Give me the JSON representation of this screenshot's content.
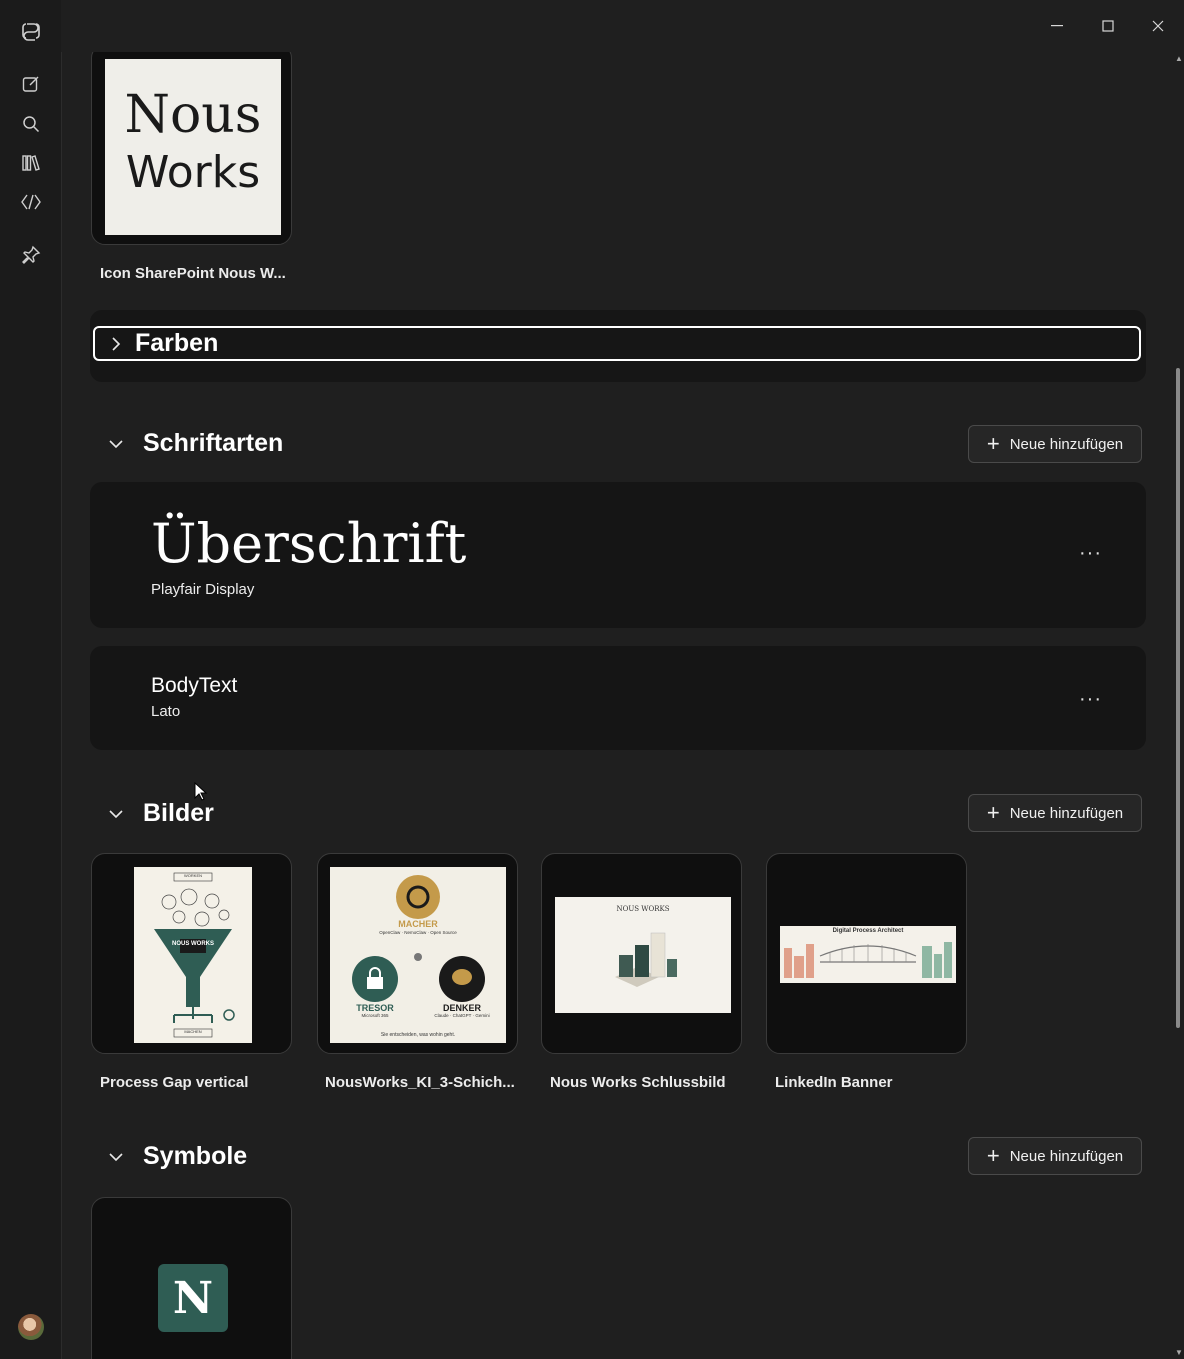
{
  "window": {
    "minimize_glyph": "—",
    "maximize_glyph": "☐",
    "close_glyph": "✕"
  },
  "sidebar": {
    "icons": [
      "copilot-logo-icon",
      "new-chat-icon",
      "search-icon",
      "library-icon",
      "code-icon",
      "pin-icon"
    ],
    "avatar": "user-avatar"
  },
  "top_tile": {
    "logo_line1": "Nous",
    "logo_line2": "Works",
    "label": "Icon SharePoint Nous W..."
  },
  "farben": {
    "title": "Farben"
  },
  "schriftarten": {
    "title": "Schriftarten",
    "add_label": "Neue hinzufügen",
    "fonts": [
      {
        "sample": "Überschrift",
        "family": "Playfair Display",
        "menu": "···"
      },
      {
        "sample": "BodyText",
        "family": "Lato",
        "menu": "···"
      }
    ]
  },
  "bilder": {
    "title": "Bilder",
    "add_label": "Neue hinzufügen",
    "items": [
      {
        "label": "Process Gap vertical",
        "thumb_title": "NOUS WORKS",
        "top": "WORKEN",
        "bottom": "MACHEN"
      },
      {
        "label": "NousWorks_KI_3-Schich...",
        "macher": "MACHER",
        "macher_sub": "OpenClaw · NemoClaw · Open Source",
        "tresor": "TRESOR",
        "tresor_sub": "Microsoft 365",
        "denker": "DENKER",
        "denker_sub": "Claude · ChatGPT · Gemini",
        "footer": "Sie entscheiden, was wohin geht."
      },
      {
        "label": "Nous Works Schlussbild",
        "thumb_title": "NOUS WORKS"
      },
      {
        "label": "LinkedIn Banner",
        "thumb_title": "Digital Process Architect"
      }
    ]
  },
  "symbole": {
    "title": "Symbole",
    "add_label": "Neue hinzufügen",
    "items": [
      {
        "letter": "N"
      }
    ]
  },
  "colors": {
    "background": "#1f1f1f",
    "card": "#151515",
    "tile": "#0f0f0f",
    "accent_green": "#2f5d54",
    "accent_gold": "#c49a4a"
  }
}
